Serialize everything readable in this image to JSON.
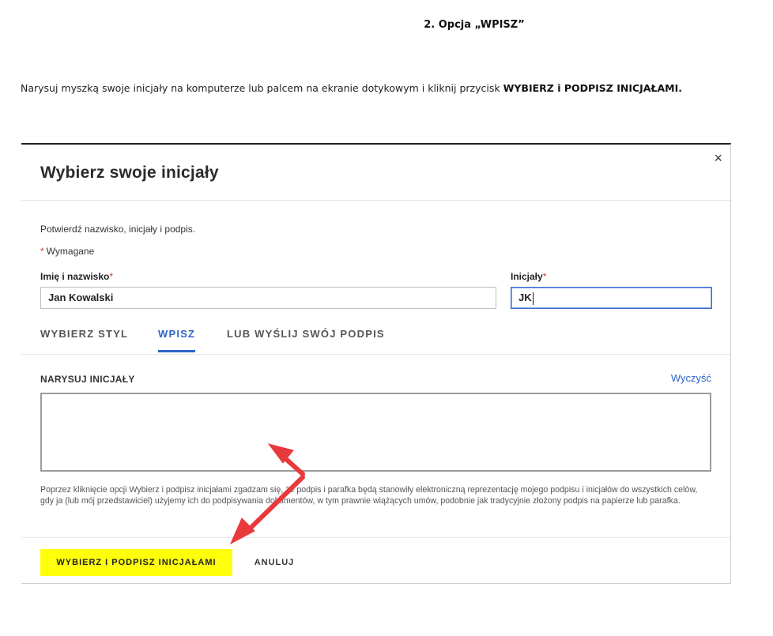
{
  "document": {
    "heading": "2. Opcja „WPISZ”",
    "intro_text": "Narysuj myszką swoje inicjały na komputerze lub palcem na ekranie dotykowym i kliknij przycisk ",
    "intro_bold": "WYBIERZ i PODPISZ INICJAŁAMI."
  },
  "modal": {
    "title": "Wybierz swoje inicjały",
    "close_glyph": "×",
    "confirm_text": "Potwierdź nazwisko, inicjały i podpis.",
    "required_star": "*",
    "required_label": "Wymagane",
    "name_field": {
      "label": "Imię i nazwisko",
      "star": "*",
      "value": "Jan Kowalski"
    },
    "initials_field": {
      "label": "Inicjały",
      "star": "*",
      "value": "JK"
    },
    "tabs": [
      {
        "label": "WYBIERZ STYL",
        "active": false
      },
      {
        "label": "WPISZ",
        "active": true
      },
      {
        "label": "LUB WYŚLIJ SWÓJ PODPIS",
        "active": false
      }
    ],
    "draw_section_title": "NARYSUJ INICJAŁY",
    "clear_label": "Wyczyść",
    "legal_text": "Poprzez kliknięcie opcji Wybierz i podpisz inicjałami zgadzam się, że podpis i parafka będą stanowiły elektroniczną reprezentację mojego podpisu i inicjałów do wszystkich celów, gdy ja (lub mój przedstawiciel) użyjemy ich do podpisywania dokumentów, w tym prawnie wiążących umów, podobnie jak tradycyjnie złożony podpis na papierze lub parafka.",
    "sign_button_label": "WYBIERZ I PODPISZ INICJAŁAMI",
    "cancel_button_label": "ANULUJ"
  },
  "colors": {
    "accent": "#2f64c8",
    "highlight": "#ffff0a",
    "annotation_arrow": "#e8393c",
    "required": "#c0392b"
  }
}
